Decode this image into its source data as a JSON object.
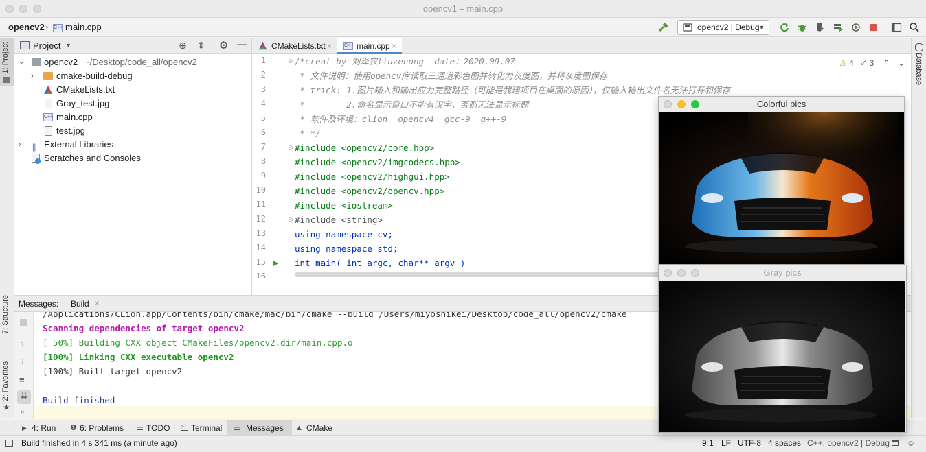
{
  "window": {
    "title": "opencv1 – main.cpp"
  },
  "navbar": {
    "project": "opencv2",
    "file": "main.cpp",
    "run_config": "opencv2 | Debug"
  },
  "left_strip": {
    "project_tab": "1: Project",
    "structure_tab": "7: Structure",
    "favorites_tab": "2: Favorites"
  },
  "right_strip": {
    "database_tab": "Database"
  },
  "project_panel": {
    "title": "Project",
    "root": {
      "name": "opencv2",
      "path": "~/Desktop/code_all/opencv2"
    },
    "items": [
      {
        "name": "cmake-build-debug"
      },
      {
        "name": "CMakeLists.txt"
      },
      {
        "name": "Gray_test.jpg"
      },
      {
        "name": "main.cpp"
      },
      {
        "name": "test.jpg"
      }
    ],
    "external": "External Libraries",
    "scratches": "Scratches and Consoles"
  },
  "editor": {
    "tabs": [
      {
        "label": "CMakeLists.txt"
      },
      {
        "label": "main.cpp"
      }
    ],
    "warnings": "4",
    "checks": "3",
    "line_numbers": [
      "1",
      "2",
      "3",
      "4",
      "5",
      "6",
      "7",
      "8",
      "9",
      "10",
      "11",
      "12",
      "13",
      "14",
      "15",
      "16"
    ],
    "lines": [
      "/*creat by 刘泽农liuzenong  date：2020.09.07",
      " * 文件说明：使用opencv库读取三通道彩色图并转化为灰度图，并将灰度图保存",
      " * trick: 1.图片输入和输出应为完整路径（可能是我建项目在桌面的原因），仅输入输出文件名无法打开和保存",
      " *        2.命名显示窗口不能有汉字，否则无法显示标题",
      " * 软件及环境：clion  opencv4  gcc-9  g++-9",
      " * */",
      "#include <opencv2/core.hpp>",
      "#include <opencv2/imgcodecs.hpp>",
      "#include <opencv2/highgui.hpp>",
      "#include <opencv2/opencv.hpp>",
      "#include <iostream>",
      "#include <string>",
      "using namespace cv;",
      "using namespace std;",
      "int main( int argc, char** argv )"
    ]
  },
  "messages": {
    "label": "Messages:",
    "tab": "Build",
    "lines": [
      "/Applications/CLion.app/Contents/bin/cmake/mac/bin/cmake --build /Users/miyoshikei/Desktop/code_all/opencv2/cmake",
      "Scanning dependencies of target opencv2",
      "[ 50%] Building CXX object CMakeFiles/opencv2.dir/main.cpp.o",
      "[100%] Linking CXX executable opencv2",
      "[100%] Built target opencv2",
      "",
      "Build finished"
    ]
  },
  "tool_windows": [
    {
      "label": "4: Run"
    },
    {
      "label": "6: Problems"
    },
    {
      "label": "TODO"
    },
    {
      "label": "Terminal"
    },
    {
      "label": "Messages"
    },
    {
      "label": "CMake"
    }
  ],
  "status_bar": {
    "message": "Build finished in 4 s 341 ms (a minute ago)",
    "position": "9:1",
    "line_ending": "LF",
    "encoding": "UTF-8",
    "indent": "4 spaces",
    "context": "C++: opencv2 | Debug"
  },
  "image_windows": {
    "colorful": {
      "title": "Colorful pics"
    },
    "gray": {
      "title": "Gray pics"
    }
  }
}
